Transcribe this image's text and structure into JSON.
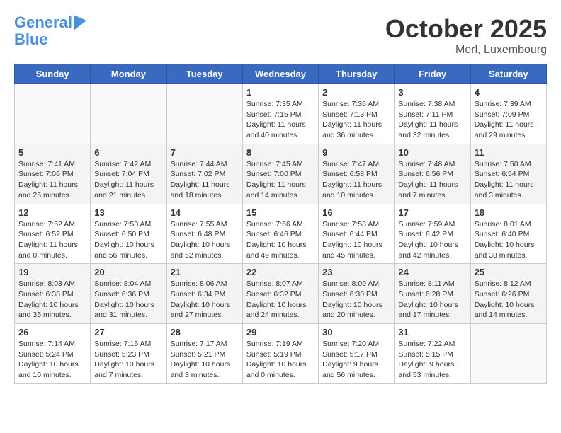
{
  "header": {
    "logo_line1": "General",
    "logo_line2": "Blue",
    "month": "October 2025",
    "location": "Merl, Luxembourg"
  },
  "weekdays": [
    "Sunday",
    "Monday",
    "Tuesday",
    "Wednesday",
    "Thursday",
    "Friday",
    "Saturday"
  ],
  "weeks": [
    [
      {
        "day": "",
        "sunrise": "",
        "sunset": "",
        "daylight": ""
      },
      {
        "day": "",
        "sunrise": "",
        "sunset": "",
        "daylight": ""
      },
      {
        "day": "",
        "sunrise": "",
        "sunset": "",
        "daylight": ""
      },
      {
        "day": "1",
        "sunrise": "Sunrise: 7:35 AM",
        "sunset": "Sunset: 7:15 PM",
        "daylight": "Daylight: 11 hours and 40 minutes."
      },
      {
        "day": "2",
        "sunrise": "Sunrise: 7:36 AM",
        "sunset": "Sunset: 7:13 PM",
        "daylight": "Daylight: 11 hours and 36 minutes."
      },
      {
        "day": "3",
        "sunrise": "Sunrise: 7:38 AM",
        "sunset": "Sunset: 7:11 PM",
        "daylight": "Daylight: 11 hours and 32 minutes."
      },
      {
        "day": "4",
        "sunrise": "Sunrise: 7:39 AM",
        "sunset": "Sunset: 7:09 PM",
        "daylight": "Daylight: 11 hours and 29 minutes."
      }
    ],
    [
      {
        "day": "5",
        "sunrise": "Sunrise: 7:41 AM",
        "sunset": "Sunset: 7:06 PM",
        "daylight": "Daylight: 11 hours and 25 minutes."
      },
      {
        "day": "6",
        "sunrise": "Sunrise: 7:42 AM",
        "sunset": "Sunset: 7:04 PM",
        "daylight": "Daylight: 11 hours and 21 minutes."
      },
      {
        "day": "7",
        "sunrise": "Sunrise: 7:44 AM",
        "sunset": "Sunset: 7:02 PM",
        "daylight": "Daylight: 11 hours and 18 minutes."
      },
      {
        "day": "8",
        "sunrise": "Sunrise: 7:45 AM",
        "sunset": "Sunset: 7:00 PM",
        "daylight": "Daylight: 11 hours and 14 minutes."
      },
      {
        "day": "9",
        "sunrise": "Sunrise: 7:47 AM",
        "sunset": "Sunset: 6:58 PM",
        "daylight": "Daylight: 11 hours and 10 minutes."
      },
      {
        "day": "10",
        "sunrise": "Sunrise: 7:48 AM",
        "sunset": "Sunset: 6:56 PM",
        "daylight": "Daylight: 11 hours and 7 minutes."
      },
      {
        "day": "11",
        "sunrise": "Sunrise: 7:50 AM",
        "sunset": "Sunset: 6:54 PM",
        "daylight": "Daylight: 11 hours and 3 minutes."
      }
    ],
    [
      {
        "day": "12",
        "sunrise": "Sunrise: 7:52 AM",
        "sunset": "Sunset: 6:52 PM",
        "daylight": "Daylight: 11 hours and 0 minutes."
      },
      {
        "day": "13",
        "sunrise": "Sunrise: 7:53 AM",
        "sunset": "Sunset: 6:50 PM",
        "daylight": "Daylight: 10 hours and 56 minutes."
      },
      {
        "day": "14",
        "sunrise": "Sunrise: 7:55 AM",
        "sunset": "Sunset: 6:48 PM",
        "daylight": "Daylight: 10 hours and 52 minutes."
      },
      {
        "day": "15",
        "sunrise": "Sunrise: 7:56 AM",
        "sunset": "Sunset: 6:46 PM",
        "daylight": "Daylight: 10 hours and 49 minutes."
      },
      {
        "day": "16",
        "sunrise": "Sunrise: 7:58 AM",
        "sunset": "Sunset: 6:44 PM",
        "daylight": "Daylight: 10 hours and 45 minutes."
      },
      {
        "day": "17",
        "sunrise": "Sunrise: 7:59 AM",
        "sunset": "Sunset: 6:42 PM",
        "daylight": "Daylight: 10 hours and 42 minutes."
      },
      {
        "day": "18",
        "sunrise": "Sunrise: 8:01 AM",
        "sunset": "Sunset: 6:40 PM",
        "daylight": "Daylight: 10 hours and 38 minutes."
      }
    ],
    [
      {
        "day": "19",
        "sunrise": "Sunrise: 8:03 AM",
        "sunset": "Sunset: 6:38 PM",
        "daylight": "Daylight: 10 hours and 35 minutes."
      },
      {
        "day": "20",
        "sunrise": "Sunrise: 8:04 AM",
        "sunset": "Sunset: 6:36 PM",
        "daylight": "Daylight: 10 hours and 31 minutes."
      },
      {
        "day": "21",
        "sunrise": "Sunrise: 8:06 AM",
        "sunset": "Sunset: 6:34 PM",
        "daylight": "Daylight: 10 hours and 27 minutes."
      },
      {
        "day": "22",
        "sunrise": "Sunrise: 8:07 AM",
        "sunset": "Sunset: 6:32 PM",
        "daylight": "Daylight: 10 hours and 24 minutes."
      },
      {
        "day": "23",
        "sunrise": "Sunrise: 8:09 AM",
        "sunset": "Sunset: 6:30 PM",
        "daylight": "Daylight: 10 hours and 20 minutes."
      },
      {
        "day": "24",
        "sunrise": "Sunrise: 8:11 AM",
        "sunset": "Sunset: 6:28 PM",
        "daylight": "Daylight: 10 hours and 17 minutes."
      },
      {
        "day": "25",
        "sunrise": "Sunrise: 8:12 AM",
        "sunset": "Sunset: 6:26 PM",
        "daylight": "Daylight: 10 hours and 14 minutes."
      }
    ],
    [
      {
        "day": "26",
        "sunrise": "Sunrise: 7:14 AM",
        "sunset": "Sunset: 5:24 PM",
        "daylight": "Daylight: 10 hours and 10 minutes."
      },
      {
        "day": "27",
        "sunrise": "Sunrise: 7:15 AM",
        "sunset": "Sunset: 5:23 PM",
        "daylight": "Daylight: 10 hours and 7 minutes."
      },
      {
        "day": "28",
        "sunrise": "Sunrise: 7:17 AM",
        "sunset": "Sunset: 5:21 PM",
        "daylight": "Daylight: 10 hours and 3 minutes."
      },
      {
        "day": "29",
        "sunrise": "Sunrise: 7:19 AM",
        "sunset": "Sunset: 5:19 PM",
        "daylight": "Daylight: 10 hours and 0 minutes."
      },
      {
        "day": "30",
        "sunrise": "Sunrise: 7:20 AM",
        "sunset": "Sunset: 5:17 PM",
        "daylight": "Daylight: 9 hours and 56 minutes."
      },
      {
        "day": "31",
        "sunrise": "Sunrise: 7:22 AM",
        "sunset": "Sunset: 5:15 PM",
        "daylight": "Daylight: 9 hours and 53 minutes."
      },
      {
        "day": "",
        "sunrise": "",
        "sunset": "",
        "daylight": ""
      }
    ]
  ]
}
